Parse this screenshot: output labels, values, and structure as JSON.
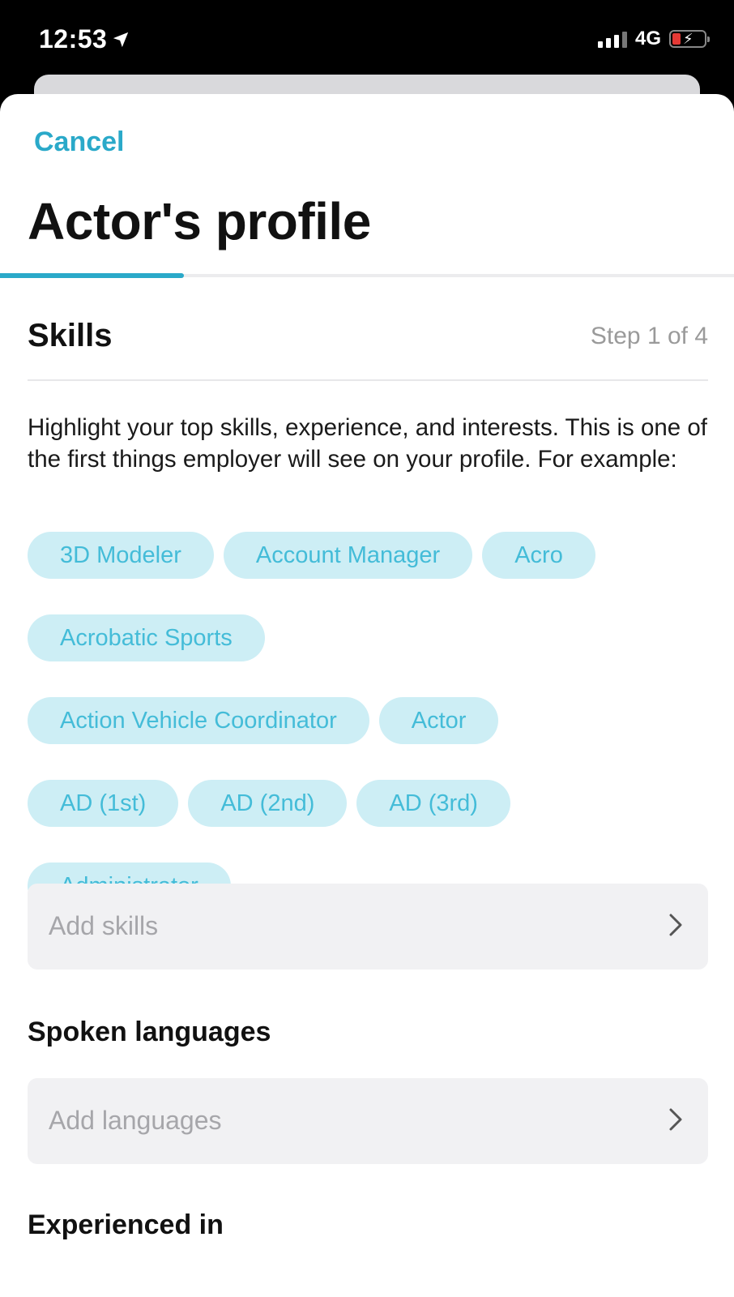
{
  "status_bar": {
    "time": "12:53",
    "network": "4G",
    "icons": [
      "location-arrow-icon",
      "signal-icon",
      "battery-charging-icon"
    ]
  },
  "header": {
    "cancel_label": "Cancel",
    "title": "Actor's profile",
    "progress_fraction": 0.25
  },
  "skills": {
    "title": "Skills",
    "step": "Step 1 of 4",
    "description": "Highlight your top skills, experience, and interests. This is one of the first things employer will see on your profile. For example:",
    "examples": [
      "3D Modeler",
      "Account Manager",
      "Acro",
      "Acrobatic Sports",
      "Action Vehicle Coordinator",
      "Actor",
      "AD (1st)",
      "AD (2nd)",
      "AD (3rd)",
      "Administrator"
    ],
    "add_placeholder": "Add skills"
  },
  "languages": {
    "title": "Spoken languages",
    "add_placeholder": "Add languages"
  },
  "experience": {
    "title": "Experienced in"
  },
  "colors": {
    "accent": "#2aa9c9",
    "chip_bg": "#cdeef5",
    "chip_text": "#44bcd8",
    "field_bg": "#f1f1f3"
  }
}
